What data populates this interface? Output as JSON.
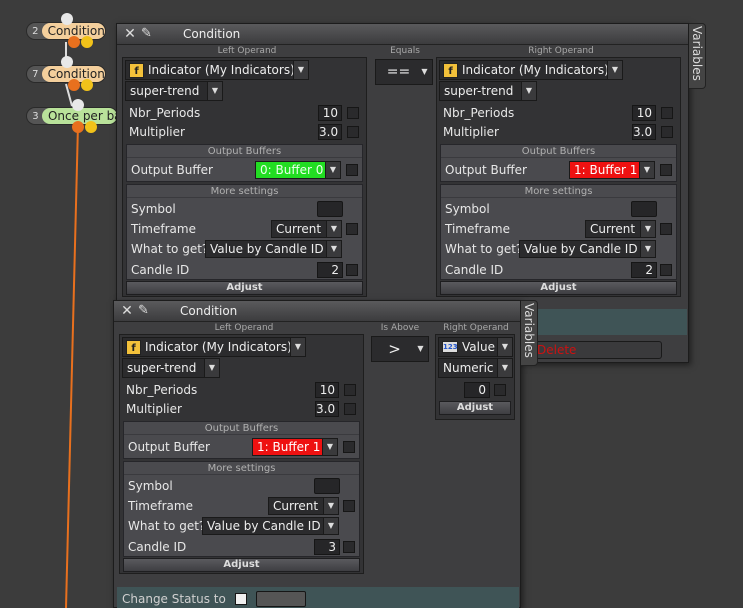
{
  "colors": {
    "node_orange": "#f4cf9c",
    "node_green": "#b9e29a",
    "wire_orange": "#e8701e",
    "buffer_green": "#22dd22",
    "buffer_red": "#ee1111",
    "status_strip": "#3f5456",
    "delete_text": "#cc1111"
  },
  "flow_nodes": [
    {
      "num": "2",
      "label": "Condition"
    },
    {
      "num": "7",
      "label": "Condition"
    },
    {
      "num": "3",
      "label": "Once per bar"
    }
  ],
  "window1": {
    "title": "Condition",
    "side_tab": "Variables",
    "left_operand_header": "Left Operand",
    "operator_header": "Equals",
    "right_operand_header": "Right Operand",
    "operator": "==",
    "delete_label": "Delete",
    "left": {
      "source": "Indicator (My Indicators)",
      "indicator": "super-trend",
      "params": [
        {
          "label": "Nbr_Periods",
          "value": "10"
        },
        {
          "label": "Multiplier",
          "value": "3.0"
        }
      ],
      "output_buffers_header": "Output Buffers",
      "output_buffer_label": "Output Buffer",
      "output_buffer_value": "0: Buffer 0",
      "more_settings_header": "More settings",
      "symbol_label": "Symbol",
      "timeframe_label": "Timeframe",
      "timeframe_value": "Current",
      "what_label": "What to get?",
      "what_value": "Value by Candle ID",
      "candle_label": "Candle ID",
      "candle_value": "2",
      "adjust_label": "Adjust"
    },
    "right": {
      "source": "Indicator (My Indicators)",
      "indicator": "super-trend",
      "params": [
        {
          "label": "Nbr_Periods",
          "value": "10"
        },
        {
          "label": "Multiplier",
          "value": "3.0"
        }
      ],
      "output_buffers_header": "Output Buffers",
      "output_buffer_label": "Output Buffer",
      "output_buffer_value": "1: Buffer 1",
      "more_settings_header": "More settings",
      "symbol_label": "Symbol",
      "timeframe_label": "Timeframe",
      "timeframe_value": "Current",
      "what_label": "What to get?",
      "what_value": "Value by Candle ID",
      "candle_label": "Candle ID",
      "candle_value": "2",
      "adjust_label": "Adjust"
    }
  },
  "window2": {
    "title": "Condition",
    "side_tab": "Variables",
    "left_operand_header": "Left Operand",
    "operator_header": "Is Above",
    "right_operand_header": "Right Operand",
    "operator": ">",
    "left": {
      "source": "Indicator (My Indicators)",
      "indicator": "super-trend",
      "params": [
        {
          "label": "Nbr_Periods",
          "value": "10"
        },
        {
          "label": "Multiplier",
          "value": "3.0"
        }
      ],
      "output_buffers_header": "Output Buffers",
      "output_buffer_label": "Output Buffer",
      "output_buffer_value": "1: Buffer 1",
      "more_settings_header": "More settings",
      "symbol_label": "Symbol",
      "timeframe_label": "Timeframe",
      "timeframe_value": "Current",
      "what_label": "What to get?",
      "what_value": "Value by Candle ID",
      "candle_label": "Candle ID",
      "candle_value": "3",
      "adjust_label": "Adjust"
    },
    "right": {
      "source": "Value",
      "type": "Numeric",
      "value": "0",
      "adjust_label": "Adjust"
    },
    "change_status_label": "Change Status to"
  }
}
